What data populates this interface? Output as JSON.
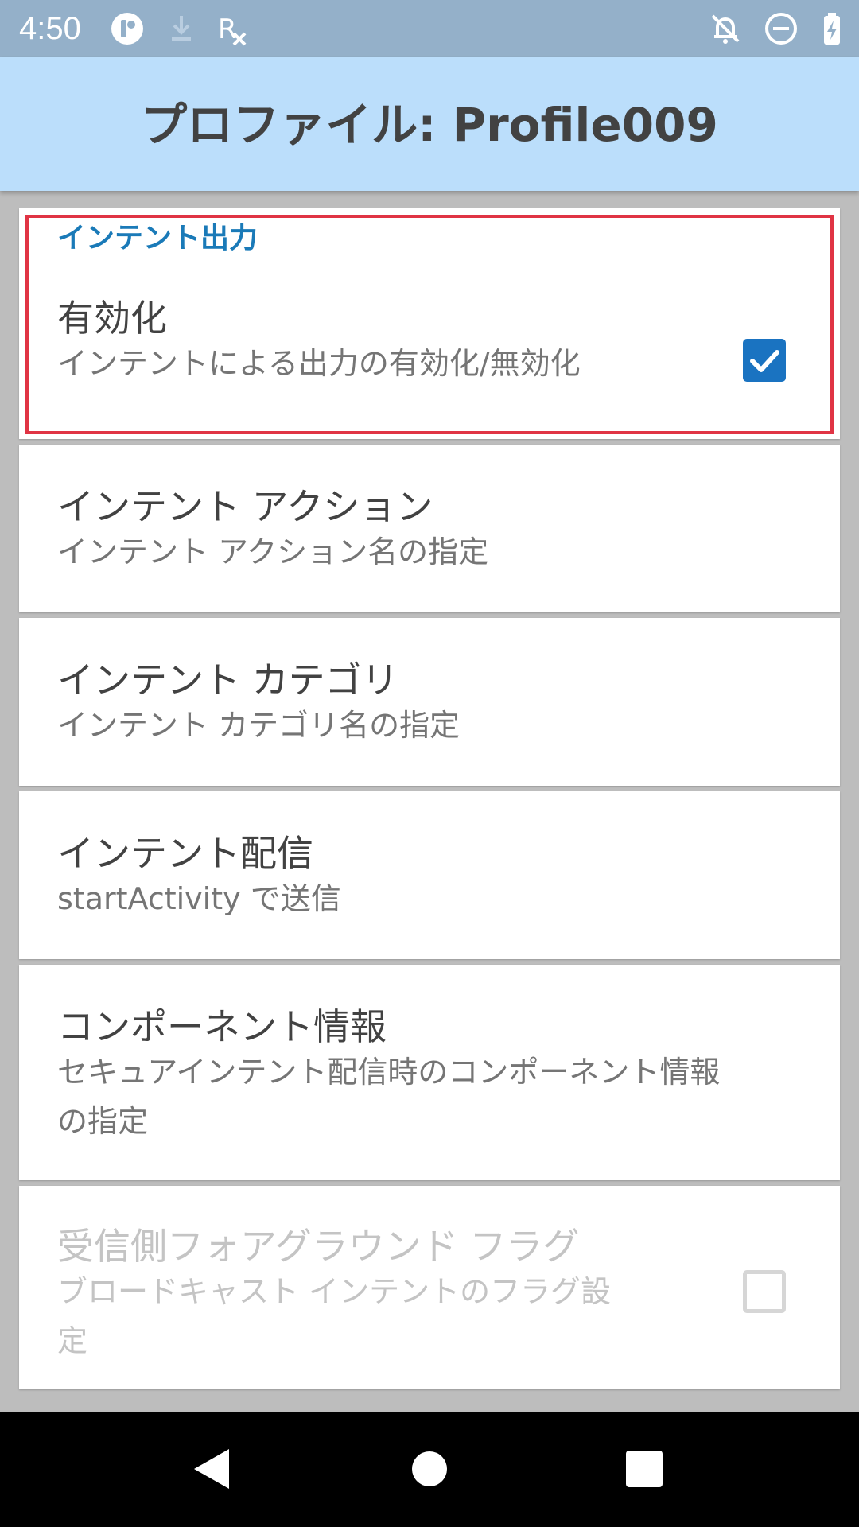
{
  "status_bar": {
    "time": "4:50",
    "icons": [
      "app-notification-icon",
      "download-icon",
      "rx-icon",
      "notifications-off-icon",
      "do-not-disturb-icon",
      "battery-charging-icon"
    ]
  },
  "app_bar": {
    "title": "プロファイル: Profile009"
  },
  "preferences": {
    "category": "インテント出力",
    "enable": {
      "title": "有効化",
      "summary": "インテントによる出力の有効化/無効化",
      "checked": true
    },
    "action": {
      "title": "インテント アクション",
      "summary": "インテント アクション名の指定"
    },
    "category_item": {
      "title": "インテント カテゴリ",
      "summary": "インテント カテゴリ名の指定"
    },
    "delivery": {
      "title": "インテント配信",
      "summary": "startActivity で送信"
    },
    "component": {
      "title": "コンポーネント情報",
      "summary_line1": "セキュアインテント配信時のコンポーネント情報",
      "summary_line2": "の指定"
    },
    "foreground_flag": {
      "title": "受信側フォアグラウンド フラグ",
      "summary_line1": "ブロードキャスト インテントのフラグ設",
      "summary_line2": "定",
      "checked": false,
      "enabled": false
    }
  },
  "nav_bar": {
    "icons": [
      "back-icon",
      "home-icon",
      "recents-icon"
    ]
  },
  "colors": {
    "accent": "#1a73c1",
    "category_text": "#1a7ab8",
    "app_bar_bg": "#bbdefb",
    "status_bar_bg": "#94b0c9",
    "highlight_border": "#e03444"
  }
}
